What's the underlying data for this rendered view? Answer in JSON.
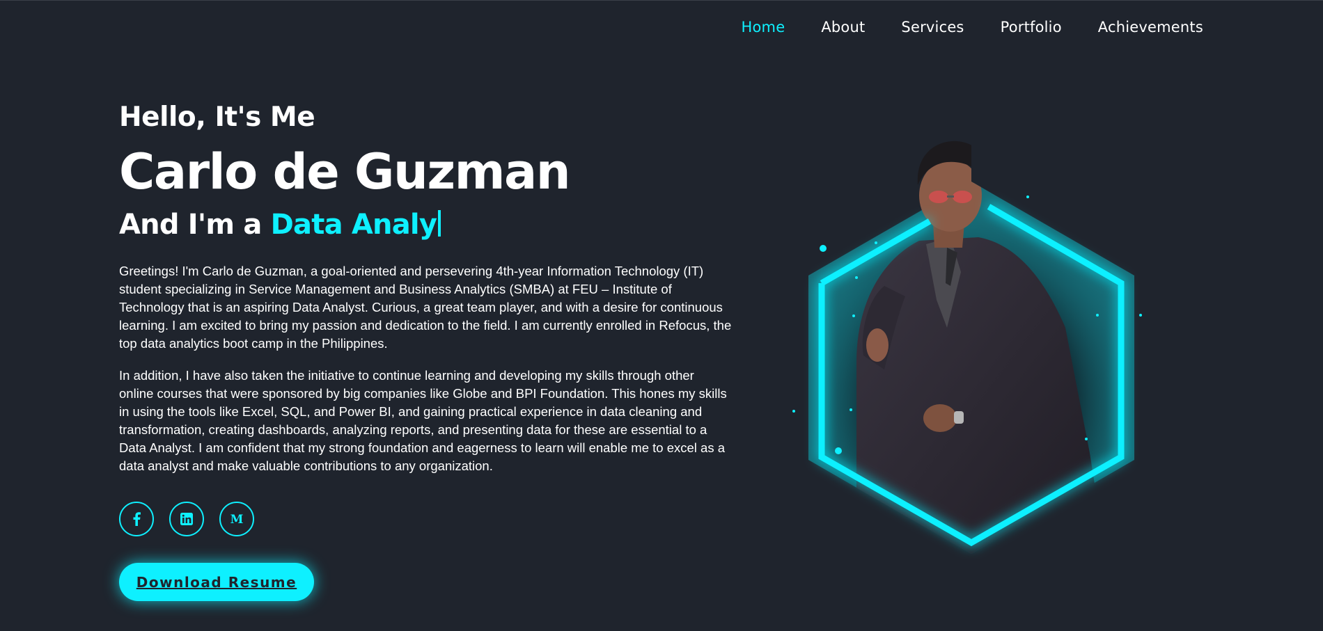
{
  "nav": {
    "items": [
      {
        "label": "Home",
        "active": true
      },
      {
        "label": "About",
        "active": false
      },
      {
        "label": "Services",
        "active": false
      },
      {
        "label": "Portfolio",
        "active": false
      },
      {
        "label": "Achievements",
        "active": false
      }
    ]
  },
  "hero": {
    "greeting": "Hello, It's Me",
    "name": "Carlo de Guzman",
    "role_prefix": "And I'm a ",
    "role_typed": "Data Analy",
    "paragraph1": "Greetings! I'm Carlo de Guzman, a goal-oriented and persevering 4th-year Information Technology (IT) student specializing in Service Management and Business Analytics (SMBA) at FEU – Institute of Technology that is an aspiring Data Analyst. Curious, a great team player, and with a desire for continuous learning. I am excited to bring my passion and dedication to the field. I am currently enrolled in Refocus, the top data analytics boot camp in the Philippines.",
    "paragraph2": "In addition, I have also taken the initiative to continue learning and developing my skills through other online courses that were sponsored by big companies like Globe and BPI Foundation. This hones my skills in using the tools like Excel, SQL, and Power BI, and gaining practical experience in data cleaning and transformation, creating dashboards, analyzing reports, and presenting data for these are essential to a Data Analyst. I am confident that my strong foundation and eagerness to learn will enable me to excel as a data analyst and make valuable contributions to any organization.",
    "socials": [
      {
        "icon": "facebook-icon",
        "glyph": "f"
      },
      {
        "icon": "linkedin-icon",
        "glyph": "in"
      },
      {
        "icon": "medium-icon",
        "glyph": "M"
      }
    ],
    "button_label": "Download Resume"
  },
  "colors": {
    "background": "#1f242d",
    "accent": "#0ef0ff",
    "text": "#ffffff"
  }
}
